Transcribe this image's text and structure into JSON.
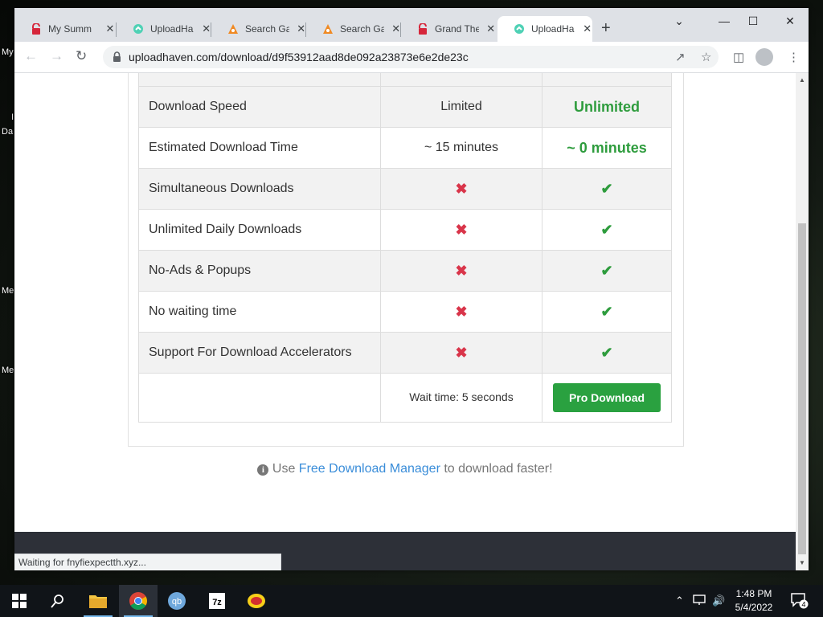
{
  "desktop": {
    "labels": [
      "My",
      "I",
      "Da",
      "Me",
      "Me"
    ]
  },
  "tabs": [
    {
      "label": "My Summ",
      "icon": "pdf-icon",
      "active": false
    },
    {
      "label": "UploadHa",
      "icon": "uploadhaven-icon",
      "active": false
    },
    {
      "label": "Search Ga",
      "icon": "search-game-icon",
      "active": false
    },
    {
      "label": "Search Ga",
      "icon": "search-game-icon",
      "active": false
    },
    {
      "label": "Grand The",
      "icon": "pdf-icon",
      "active": false
    },
    {
      "label": "UploadHa",
      "icon": "uploadhaven-icon",
      "active": true
    }
  ],
  "browser": {
    "url": "uploadhaven.com/download/d9f53912aad8de092a23873e6e2de23c",
    "status": "Waiting for fnyfiexpectth.xyz..."
  },
  "comparison": {
    "rows": [
      {
        "feature": "Download Speed",
        "free": "Limited",
        "pro": "Unlimited",
        "kind": "text"
      },
      {
        "feature": "Estimated Download Time",
        "free": "~ 15 minutes",
        "pro": "~ 0 minutes",
        "kind": "text"
      },
      {
        "feature": "Simultaneous Downloads",
        "kind": "mark"
      },
      {
        "feature": "Unlimited Daily Downloads",
        "kind": "mark"
      },
      {
        "feature": "No-Ads & Popups",
        "kind": "mark"
      },
      {
        "feature": "No waiting time",
        "kind": "mark"
      },
      {
        "feature": "Support For Download Accelerators",
        "kind": "mark"
      }
    ],
    "wait_text": "Wait time: 5 seconds",
    "pro_button": "Pro Download"
  },
  "tip": {
    "prefix": "Use",
    "link": "Free Download Manager",
    "suffix": "to download faster!"
  },
  "taskbar": {
    "apps": [
      "file-explorer-icon",
      "chrome-icon",
      "qbittorrent-icon",
      "7zip-icon",
      "app-icon"
    ],
    "time": "1:48 PM",
    "date": "5/4/2022",
    "notifications": "4"
  }
}
